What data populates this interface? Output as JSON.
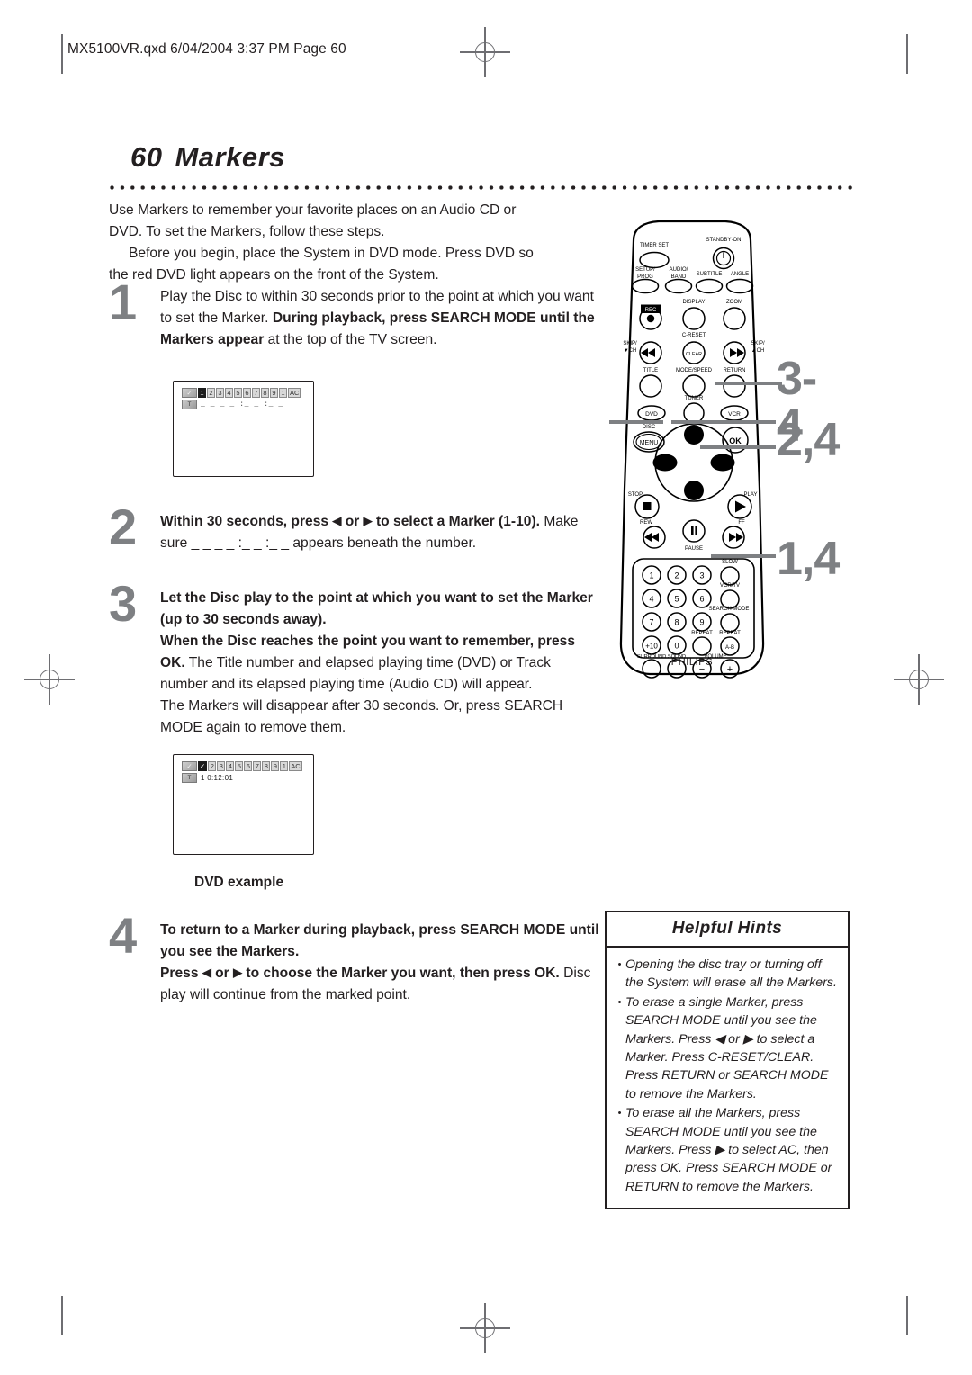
{
  "page_header": "MX5100VR.qxd  6/04/2004  3:37 PM  Page 60",
  "title": {
    "number": "60",
    "text": "Markers"
  },
  "intro": {
    "line1": "Use Markers to remember your favorite places on an Audio CD or",
    "line2": "DVD. To set the Markers, follow these steps.",
    "line3": "Before you begin, place the System in DVD mode. Press DVD so",
    "line4": "the red DVD light appears on the front of the System."
  },
  "steps": [
    {
      "number": "1",
      "para1_normal_a": "Play the Disc to within 30 seconds prior to the point at which you want to set the Marker. ",
      "para1_bold": "During playback, press SEARCH MODE until the Markers appear",
      "para1_normal_b": " at the top of the TV screen."
    },
    {
      "number": "2",
      "para1_bold_a": "Within 30 seconds, press ",
      "arrow_left": "◀",
      "para1_bold_b": " or ",
      "arrow_right": "▶",
      "para1_bold_c": " to select a Marker (1-10).",
      "para1_normal": " Make sure _ _  _ _ :_ _ :_ _  appears beneath the number."
    },
    {
      "number": "3",
      "para1_bold": "Let the Disc play to the point at which you want to set the Marker (up to 30 seconds away).",
      "para2_bold": "When the Disc reaches the point you want to remember, press OK.",
      "para2_normal": " The Title number and elapsed playing time (DVD) or Track number and its elapsed playing time (Audio CD) will appear.",
      "para3_normal": "The Markers will disappear after 30 seconds. Or, press SEARCH MODE again to remove them."
    },
    {
      "number": "4",
      "para1_bold": "To return to a Marker during playback, press SEARCH MODE until you  see the Markers.",
      "para2_bold_a": "Press ",
      "arrow_left": "◀",
      "para2_bold_b": " or ",
      "arrow_right": "▶",
      "para2_bold_c": " to choose the Marker you want, then press OK.",
      "para2_normal": " Disc play will continue from the marked point."
    }
  ],
  "osd_first": {
    "icon_label": "✓",
    "second_icon_label": "T",
    "chips": [
      "1",
      "2",
      "3",
      "4",
      "5",
      "6",
      "7",
      "8",
      "9",
      "1",
      "AC"
    ],
    "selected_index": 0,
    "time_line": "_ _  _ _ :_ _ :_ _"
  },
  "osd_second": {
    "icon_label": "✓",
    "second_icon_label": "T",
    "chips": [
      "✓",
      "2",
      "3",
      "4",
      "5",
      "6",
      "7",
      "8",
      "9",
      "1",
      "AC"
    ],
    "selected_index": 0,
    "time_line": "1  0:12:01"
  },
  "dvd_example_caption": "DVD example",
  "hints": {
    "title": "Helpful Hints",
    "items": [
      "Opening the disc tray or turning off the System will erase all the Markers.",
      "To erase a single Marker, press SEARCH MODE until you see the Markers. Press ◀ or ▶ to select a Marker. Press C-RESET/CLEAR. Press RETURN or SEARCH MODE to remove the Markers.",
      "To erase all the Markers, press SEARCH MODE until you see the Markers. Press ▶ to select AC, then press OK. Press SEARCH MODE or RETURN to remove the Markers."
    ],
    "bullet": "•"
  },
  "remote": {
    "brand": "PHILIPS",
    "callouts": [
      {
        "label": "3-4"
      },
      {
        "label": "2,4"
      },
      {
        "label": "1,4"
      }
    ],
    "buttons": {
      "timer_set": "TIMER SET",
      "standby_on": "STANDBY·ON",
      "setup_prog_1": "SETUP/",
      "setup_prog_2": "PROG",
      "audio_band_1": "AUDIO/",
      "audio_band_2": "BAND",
      "subtitle": "SUBTITLE",
      "angle": "ANGLE",
      "rec": "REC",
      "display": "DISPLAY",
      "zoom": "ZOOM",
      "skip_down_1": "SKIP/",
      "skip_down_2": "▼CH",
      "c_reset": "C-RESET",
      "clear": "CLEAR",
      "skip_up_1": "SKIP/",
      "skip_up_2": "▲CH",
      "title": "TITLE",
      "mode_speed": "MODE/SPEED",
      "return": "RETURN",
      "tuner": "TUNER",
      "dvd": "DVD",
      "vcr": "VCR",
      "disc": "DISC",
      "menu": "MENU",
      "ok": "OK",
      "stop": "STOP",
      "play": "PLAY",
      "rew": "REW",
      "pause": "PAUSE",
      "ff": "FF",
      "slow": "SLOW",
      "vcr_tv": "VCR/TV",
      "search_mode": "SEARCH MODE",
      "repeat": "REPEAT",
      "repeat_ab_1": "REPEAT",
      "repeat_ab_2": "A-B",
      "surround": "SURROUND",
      "sound": "SOUND",
      "volume": "VOLUME",
      "vol_minus": "−",
      "vol_plus": "+",
      "plus10": "+10",
      "keys": [
        "1",
        "2",
        "3",
        "4",
        "5",
        "6",
        "7",
        "8",
        "9",
        "0"
      ]
    }
  }
}
